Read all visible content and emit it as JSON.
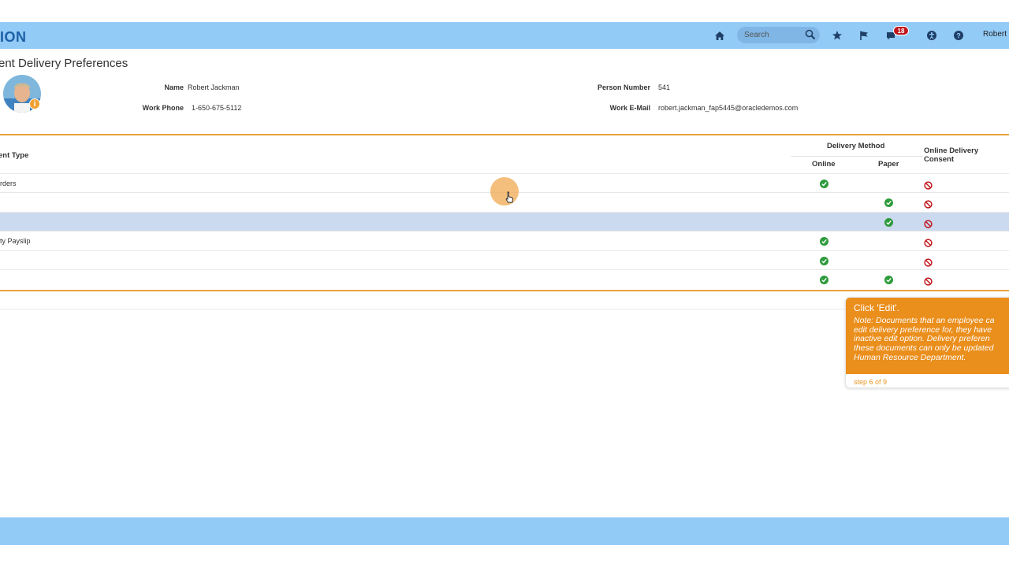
{
  "header": {
    "brand": "ION",
    "search_placeholder": "Search",
    "notifications_count": "18",
    "user": "Robert J",
    "icons": [
      "home-icon",
      "search-icon",
      "star-icon",
      "flag-icon",
      "bell-icon",
      "accessibility-icon",
      "help-icon"
    ],
    "color": "#93cbf7"
  },
  "page": {
    "title": "ent Delivery Preferences"
  },
  "person": {
    "name_label": "Name",
    "name_value": "Robert Jackman",
    "phone_label": "Work Phone",
    "phone_value": "1-650-675-5112",
    "number_label": "Person Number",
    "number_value": "541",
    "email_label": "Work E-Mail",
    "email_value": "robert.jackman_fap5445@oracledemos.com"
  },
  "table": {
    "col_type": "ent Type",
    "col_delivery": "Delivery Method",
    "col_online": "Online",
    "col_paper": "Paper",
    "col_consent_1": "Online Delivery",
    "col_consent_2": "Consent",
    "rows": [
      {
        "label": "rders",
        "online": true,
        "paper": false,
        "consent": false
      },
      {
        "label": "",
        "online": false,
        "paper": true,
        "consent": false
      },
      {
        "label": "",
        "online": false,
        "paper": true,
        "consent": false,
        "selected": true
      },
      {
        "label": "ty Payslip",
        "online": true,
        "paper": false,
        "consent": false
      },
      {
        "label": "",
        "online": true,
        "paper": false,
        "consent": false
      },
      {
        "label": "",
        "online": true,
        "paper": true,
        "consent": false
      }
    ]
  },
  "tooltip": {
    "title": "Click 'Edit'.",
    "note": "Note: Documents that an employee ca\nedit delivery preference for, they have\ninactive edit option. Delivery preferen\nthese documents can only be updated\nHuman Resource Department.",
    "step": "step 6 of 9",
    "color": "#ea8e1c"
  },
  "colors": {
    "accent_orange": "#e8a33d",
    "check_green": "#2e9b3c",
    "deny_red": "#c0161b",
    "selected_row": "#cbdaee"
  }
}
